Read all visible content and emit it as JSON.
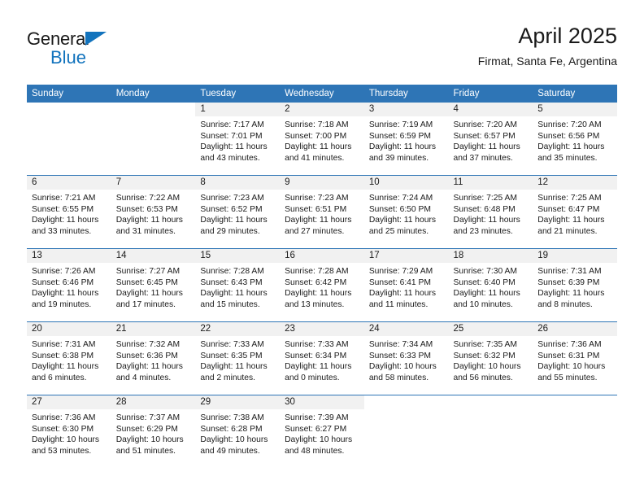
{
  "brand": {
    "line1": "General",
    "line2": "Blue",
    "triangle_color": "#1273bd"
  },
  "header": {
    "title": "April 2025",
    "subtitle": "Firmat, Santa Fe, Argentina",
    "accent_color": "#2e75b6",
    "daynum_band_color": "#f1f1f1"
  },
  "weekday_headers": [
    "Sunday",
    "Monday",
    "Tuesday",
    "Wednesday",
    "Thursday",
    "Friday",
    "Saturday"
  ],
  "weeks": [
    {
      "days": [
        {
          "num": "",
          "sunrise": "",
          "sunset": "",
          "daylight_l1": "",
          "daylight_l2": ""
        },
        {
          "num": "",
          "sunrise": "",
          "sunset": "",
          "daylight_l1": "",
          "daylight_l2": ""
        },
        {
          "num": "1",
          "sunrise": "Sunrise: 7:17 AM",
          "sunset": "Sunset: 7:01 PM",
          "daylight_l1": "Daylight: 11 hours",
          "daylight_l2": "and 43 minutes."
        },
        {
          "num": "2",
          "sunrise": "Sunrise: 7:18 AM",
          "sunset": "Sunset: 7:00 PM",
          "daylight_l1": "Daylight: 11 hours",
          "daylight_l2": "and 41 minutes."
        },
        {
          "num": "3",
          "sunrise": "Sunrise: 7:19 AM",
          "sunset": "Sunset: 6:59 PM",
          "daylight_l1": "Daylight: 11 hours",
          "daylight_l2": "and 39 minutes."
        },
        {
          "num": "4",
          "sunrise": "Sunrise: 7:20 AM",
          "sunset": "Sunset: 6:57 PM",
          "daylight_l1": "Daylight: 11 hours",
          "daylight_l2": "and 37 minutes."
        },
        {
          "num": "5",
          "sunrise": "Sunrise: 7:20 AM",
          "sunset": "Sunset: 6:56 PM",
          "daylight_l1": "Daylight: 11 hours",
          "daylight_l2": "and 35 minutes."
        }
      ]
    },
    {
      "days": [
        {
          "num": "6",
          "sunrise": "Sunrise: 7:21 AM",
          "sunset": "Sunset: 6:55 PM",
          "daylight_l1": "Daylight: 11 hours",
          "daylight_l2": "and 33 minutes."
        },
        {
          "num": "7",
          "sunrise": "Sunrise: 7:22 AM",
          "sunset": "Sunset: 6:53 PM",
          "daylight_l1": "Daylight: 11 hours",
          "daylight_l2": "and 31 minutes."
        },
        {
          "num": "8",
          "sunrise": "Sunrise: 7:23 AM",
          "sunset": "Sunset: 6:52 PM",
          "daylight_l1": "Daylight: 11 hours",
          "daylight_l2": "and 29 minutes."
        },
        {
          "num": "9",
          "sunrise": "Sunrise: 7:23 AM",
          "sunset": "Sunset: 6:51 PM",
          "daylight_l1": "Daylight: 11 hours",
          "daylight_l2": "and 27 minutes."
        },
        {
          "num": "10",
          "sunrise": "Sunrise: 7:24 AM",
          "sunset": "Sunset: 6:50 PM",
          "daylight_l1": "Daylight: 11 hours",
          "daylight_l2": "and 25 minutes."
        },
        {
          "num": "11",
          "sunrise": "Sunrise: 7:25 AM",
          "sunset": "Sunset: 6:48 PM",
          "daylight_l1": "Daylight: 11 hours",
          "daylight_l2": "and 23 minutes."
        },
        {
          "num": "12",
          "sunrise": "Sunrise: 7:25 AM",
          "sunset": "Sunset: 6:47 PM",
          "daylight_l1": "Daylight: 11 hours",
          "daylight_l2": "and 21 minutes."
        }
      ]
    },
    {
      "days": [
        {
          "num": "13",
          "sunrise": "Sunrise: 7:26 AM",
          "sunset": "Sunset: 6:46 PM",
          "daylight_l1": "Daylight: 11 hours",
          "daylight_l2": "and 19 minutes."
        },
        {
          "num": "14",
          "sunrise": "Sunrise: 7:27 AM",
          "sunset": "Sunset: 6:45 PM",
          "daylight_l1": "Daylight: 11 hours",
          "daylight_l2": "and 17 minutes."
        },
        {
          "num": "15",
          "sunrise": "Sunrise: 7:28 AM",
          "sunset": "Sunset: 6:43 PM",
          "daylight_l1": "Daylight: 11 hours",
          "daylight_l2": "and 15 minutes."
        },
        {
          "num": "16",
          "sunrise": "Sunrise: 7:28 AM",
          "sunset": "Sunset: 6:42 PM",
          "daylight_l1": "Daylight: 11 hours",
          "daylight_l2": "and 13 minutes."
        },
        {
          "num": "17",
          "sunrise": "Sunrise: 7:29 AM",
          "sunset": "Sunset: 6:41 PM",
          "daylight_l1": "Daylight: 11 hours",
          "daylight_l2": "and 11 minutes."
        },
        {
          "num": "18",
          "sunrise": "Sunrise: 7:30 AM",
          "sunset": "Sunset: 6:40 PM",
          "daylight_l1": "Daylight: 11 hours",
          "daylight_l2": "and 10 minutes."
        },
        {
          "num": "19",
          "sunrise": "Sunrise: 7:31 AM",
          "sunset": "Sunset: 6:39 PM",
          "daylight_l1": "Daylight: 11 hours",
          "daylight_l2": "and 8 minutes."
        }
      ]
    },
    {
      "days": [
        {
          "num": "20",
          "sunrise": "Sunrise: 7:31 AM",
          "sunset": "Sunset: 6:38 PM",
          "daylight_l1": "Daylight: 11 hours",
          "daylight_l2": "and 6 minutes."
        },
        {
          "num": "21",
          "sunrise": "Sunrise: 7:32 AM",
          "sunset": "Sunset: 6:36 PM",
          "daylight_l1": "Daylight: 11 hours",
          "daylight_l2": "and 4 minutes."
        },
        {
          "num": "22",
          "sunrise": "Sunrise: 7:33 AM",
          "sunset": "Sunset: 6:35 PM",
          "daylight_l1": "Daylight: 11 hours",
          "daylight_l2": "and 2 minutes."
        },
        {
          "num": "23",
          "sunrise": "Sunrise: 7:33 AM",
          "sunset": "Sunset: 6:34 PM",
          "daylight_l1": "Daylight: 11 hours",
          "daylight_l2": "and 0 minutes."
        },
        {
          "num": "24",
          "sunrise": "Sunrise: 7:34 AM",
          "sunset": "Sunset: 6:33 PM",
          "daylight_l1": "Daylight: 10 hours",
          "daylight_l2": "and 58 minutes."
        },
        {
          "num": "25",
          "sunrise": "Sunrise: 7:35 AM",
          "sunset": "Sunset: 6:32 PM",
          "daylight_l1": "Daylight: 10 hours",
          "daylight_l2": "and 56 minutes."
        },
        {
          "num": "26",
          "sunrise": "Sunrise: 7:36 AM",
          "sunset": "Sunset: 6:31 PM",
          "daylight_l1": "Daylight: 10 hours",
          "daylight_l2": "and 55 minutes."
        }
      ]
    },
    {
      "days": [
        {
          "num": "27",
          "sunrise": "Sunrise: 7:36 AM",
          "sunset": "Sunset: 6:30 PM",
          "daylight_l1": "Daylight: 10 hours",
          "daylight_l2": "and 53 minutes."
        },
        {
          "num": "28",
          "sunrise": "Sunrise: 7:37 AM",
          "sunset": "Sunset: 6:29 PM",
          "daylight_l1": "Daylight: 10 hours",
          "daylight_l2": "and 51 minutes."
        },
        {
          "num": "29",
          "sunrise": "Sunrise: 7:38 AM",
          "sunset": "Sunset: 6:28 PM",
          "daylight_l1": "Daylight: 10 hours",
          "daylight_l2": "and 49 minutes."
        },
        {
          "num": "30",
          "sunrise": "Sunrise: 7:39 AM",
          "sunset": "Sunset: 6:27 PM",
          "daylight_l1": "Daylight: 10 hours",
          "daylight_l2": "and 48 minutes."
        },
        {
          "num": "",
          "sunrise": "",
          "sunset": "",
          "daylight_l1": "",
          "daylight_l2": ""
        },
        {
          "num": "",
          "sunrise": "",
          "sunset": "",
          "daylight_l1": "",
          "daylight_l2": ""
        },
        {
          "num": "",
          "sunrise": "",
          "sunset": "",
          "daylight_l1": "",
          "daylight_l2": ""
        }
      ]
    }
  ]
}
